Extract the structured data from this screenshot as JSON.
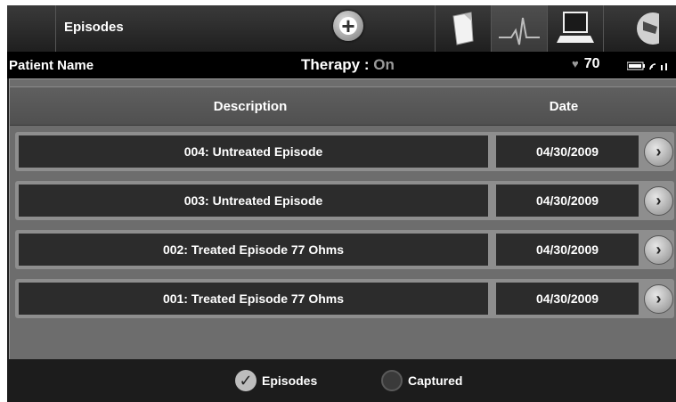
{
  "header": {
    "title": "Episodes",
    "add_label": "+",
    "nav_icons": [
      "notes-icon",
      "ecg-icon",
      "computer-icon",
      "wand-icon"
    ]
  },
  "info_bar": {
    "patient_name": "Patient Name",
    "therapy_label": "Therapy : ",
    "therapy_value": "On",
    "heart_rate": "70"
  },
  "table": {
    "columns": [
      "Description",
      "Date"
    ],
    "rows": [
      {
        "description": "004: Untreated Episode",
        "date": "04/30/2009"
      },
      {
        "description": "003: Untreated Episode",
        "date": "04/30/2009"
      },
      {
        "description": "002: Treated Episode 77 Ohms",
        "date": "04/30/2009"
      },
      {
        "description": "001: Treated Episode 77 Ohms",
        "date": "04/30/2009"
      }
    ]
  },
  "footer": {
    "options": [
      {
        "label": "Episodes",
        "selected": true
      },
      {
        "label": "Captured",
        "selected": false
      }
    ]
  },
  "colors": {
    "background": "#1d1d1d",
    "table_bg": "#6d6d6d",
    "row_bg": "#2c2c2c",
    "accent_gray": "#9a9a9a"
  }
}
